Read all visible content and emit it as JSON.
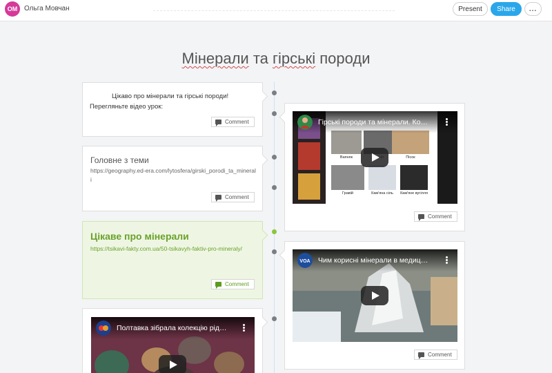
{
  "header": {
    "avatar_initials": "ОМ",
    "author": "Ольга Мовчан",
    "present_label": "Present",
    "share_label": "Share",
    "more_label": "..."
  },
  "page": {
    "title_word1": "Мінерали",
    "title_word2": " та ",
    "title_word3": "гірські",
    "title_word4": " породи"
  },
  "cards_left": [
    {
      "line1": "Цікаво про мінерали та гірські породи!",
      "line2": "Перегляньте  відео урок:",
      "comment": "Comment"
    },
    {
      "title": "Головне з теми",
      "link": "https://geography.ed-era.com/lytosfera/girski_porodi_ta_minerali",
      "comment": "Comment"
    },
    {
      "title": "Цікаве про мінерали",
      "link": " https://tsikavi-fakty.com.ua/50-tsikavyh-faktiv-pro-mineraly/",
      "comment": "Comment"
    },
    {
      "video_title": "Полтавка зібрала колекцію рід…"
    }
  ],
  "cards_right": [
    {
      "video_title": "Гірські породи та мінерали. Ко…",
      "captions": [
        "Вапняк",
        "Граніт",
        "Пісок",
        "Гравій",
        "Кам'яна сіль",
        "Кам'яне вугілля"
      ],
      "comment": "Comment"
    },
    {
      "video_title": "Чим корисні мінерали в медиц…",
      "channel_badge": "VOA",
      "comment": "Comment"
    }
  ],
  "colors": {
    "accent_blue": "#2aa7ea",
    "green_card_bg": "#eef6e3",
    "green_text": "#6aa12b",
    "avatar_bg": "#d6399a"
  }
}
